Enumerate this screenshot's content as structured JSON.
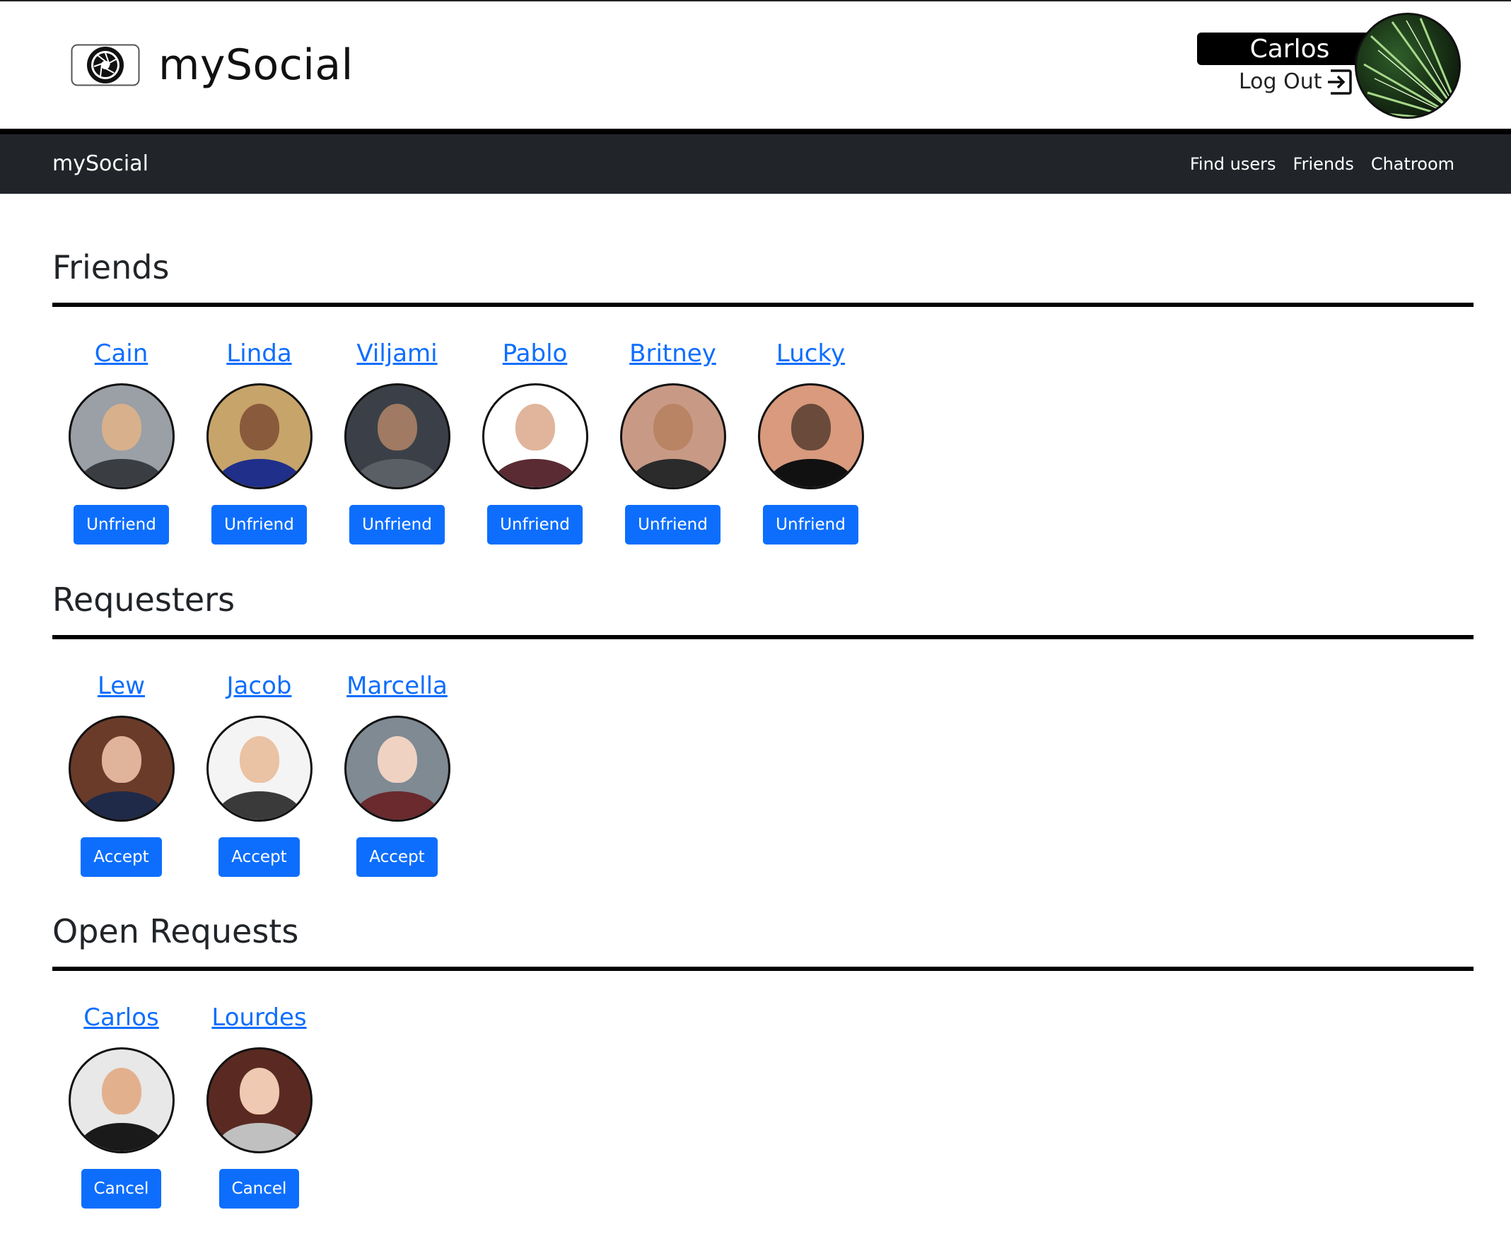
{
  "header": {
    "brand": "mySocial",
    "user_name": "Carlos",
    "logout_label": "Log Out"
  },
  "navbar": {
    "brand": "mySocial",
    "links": [
      "Find users",
      "Friends",
      "Chatroom"
    ]
  },
  "sections": {
    "friends": {
      "title": "Friends",
      "button_label": "Unfriend",
      "items": [
        {
          "name": "Cain"
        },
        {
          "name": "Linda"
        },
        {
          "name": "Viljami"
        },
        {
          "name": "Pablo"
        },
        {
          "name": "Britney"
        },
        {
          "name": "Lucky"
        }
      ]
    },
    "requesters": {
      "title": "Requesters",
      "button_label": "Accept",
      "items": [
        {
          "name": "Lew"
        },
        {
          "name": "Jacob"
        },
        {
          "name": "Marcella"
        }
      ]
    },
    "open_requests": {
      "title": "Open Requests",
      "button_label": "Cancel",
      "items": [
        {
          "name": "Carlos"
        },
        {
          "name": "Lourdes"
        }
      ]
    }
  },
  "colors": {
    "link": "#0d6efd",
    "button": "#0d6efd",
    "navbar": "#212529"
  }
}
